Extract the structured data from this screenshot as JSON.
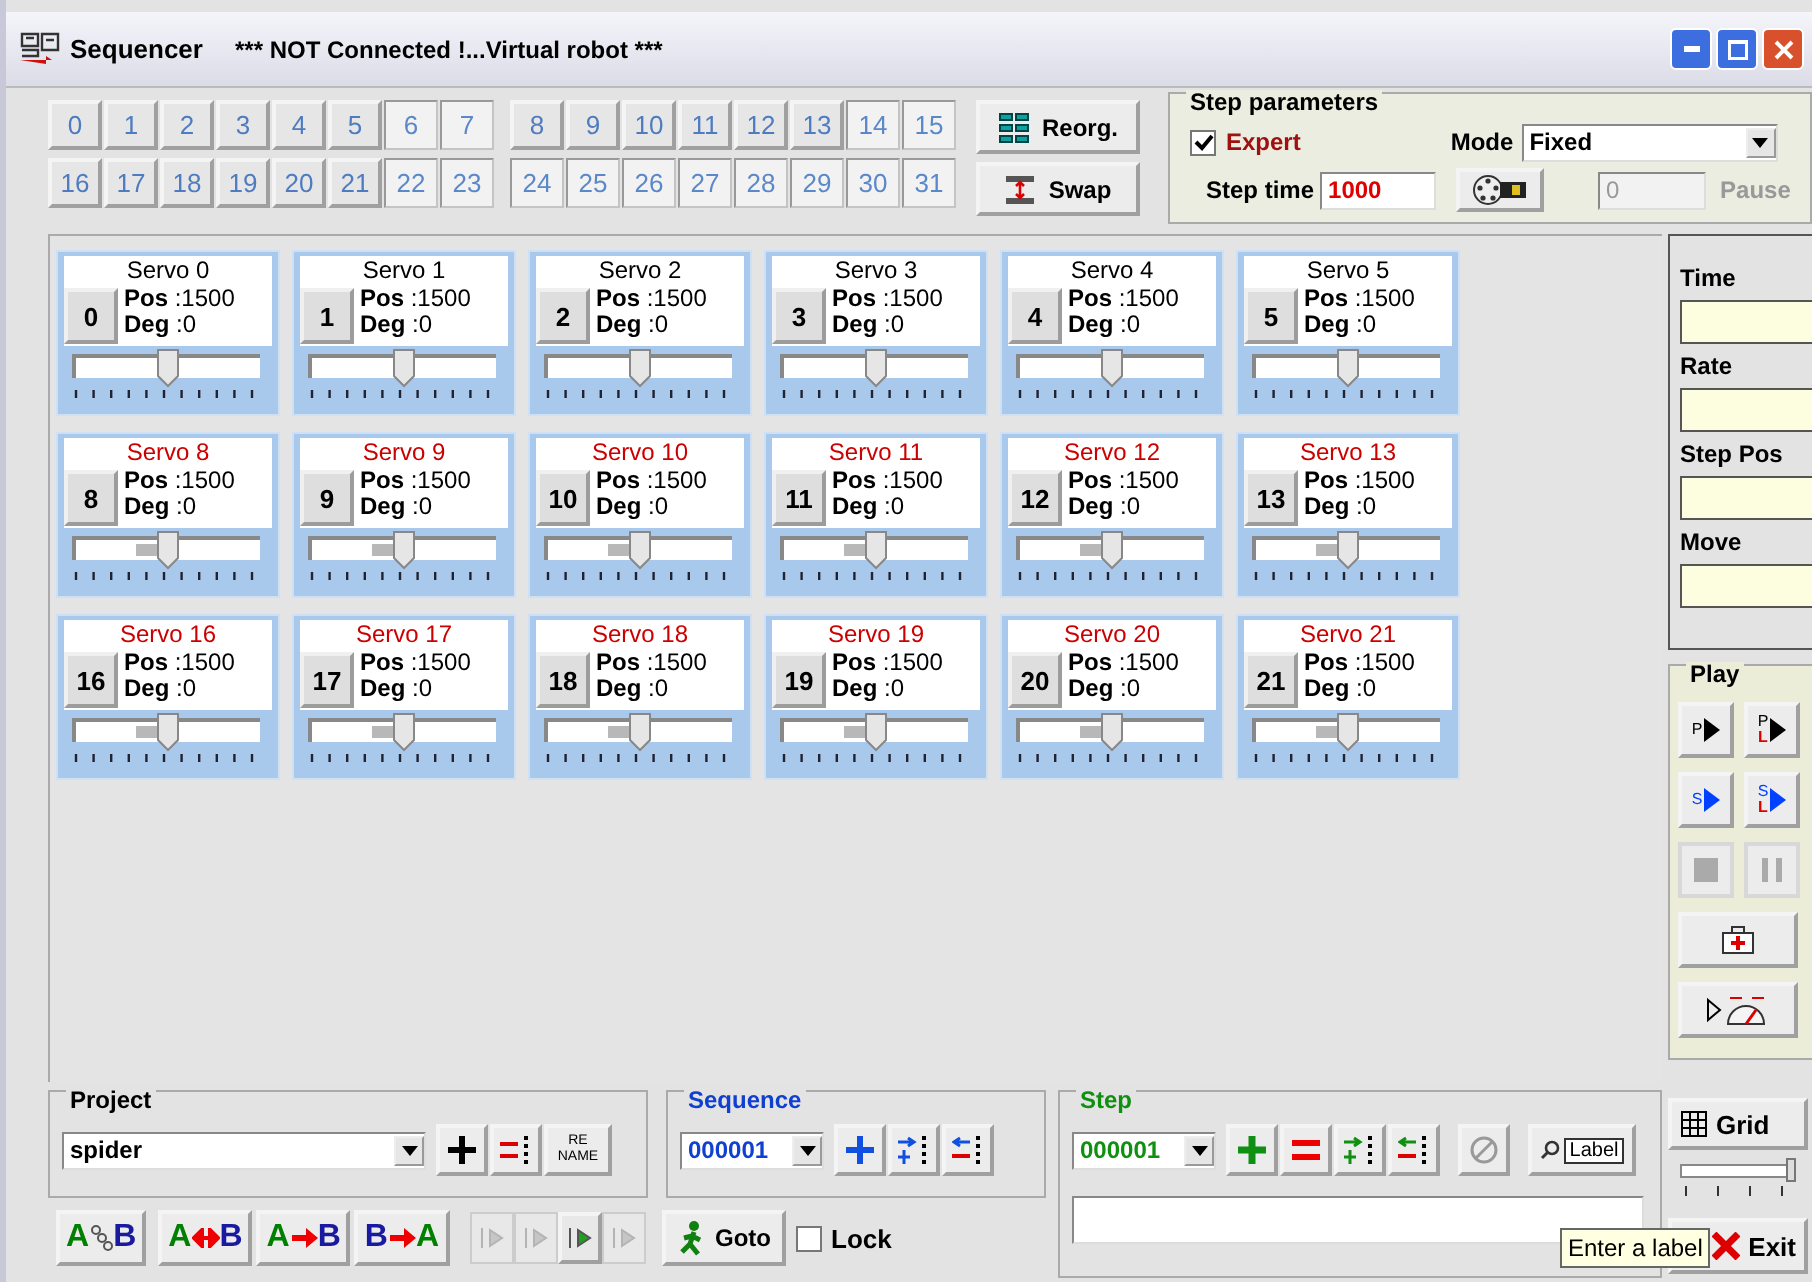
{
  "window": {
    "title": "Sequencer",
    "status": "*** NOT Connected !...Virtual robot ***"
  },
  "servo_buttons": [
    {
      "label": "0",
      "raised": true
    },
    {
      "label": "1",
      "raised": true
    },
    {
      "label": "2",
      "raised": true
    },
    {
      "label": "3",
      "raised": true
    },
    {
      "label": "4",
      "raised": true
    },
    {
      "label": "5",
      "raised": true
    },
    {
      "label": "6",
      "raised": false
    },
    {
      "label": "7",
      "raised": false
    },
    {
      "label": "8",
      "raised": true
    },
    {
      "label": "9",
      "raised": true
    },
    {
      "label": "10",
      "raised": true
    },
    {
      "label": "11",
      "raised": true
    },
    {
      "label": "12",
      "raised": true
    },
    {
      "label": "13",
      "raised": true
    },
    {
      "label": "14",
      "raised": false
    },
    {
      "label": "15",
      "raised": false
    },
    {
      "label": "16",
      "raised": true
    },
    {
      "label": "17",
      "raised": true
    },
    {
      "label": "18",
      "raised": true
    },
    {
      "label": "19",
      "raised": true
    },
    {
      "label": "20",
      "raised": true
    },
    {
      "label": "21",
      "raised": true
    },
    {
      "label": "22",
      "raised": false
    },
    {
      "label": "23",
      "raised": false
    },
    {
      "label": "24",
      "raised": false
    },
    {
      "label": "25",
      "raised": false
    },
    {
      "label": "26",
      "raised": false
    },
    {
      "label": "27",
      "raised": false
    },
    {
      "label": "28",
      "raised": false
    },
    {
      "label": "29",
      "raised": false
    },
    {
      "label": "30",
      "raised": false
    },
    {
      "label": "31",
      "raised": false
    }
  ],
  "reorg_button": "Reorg.",
  "swap_button": "Swap",
  "step_parameters": {
    "title": "Step parameters",
    "expert": {
      "label": "Expert",
      "checked": true
    },
    "mode_label": "Mode",
    "mode": "Fixed",
    "step_time_label": "Step time",
    "step_time": "1000",
    "pause_value": "0",
    "pause_label": "Pause"
  },
  "servos": [
    {
      "title": "Servo 0",
      "number": "0",
      "pos_label": "Pos",
      "pos": ":1500",
      "deg_label": "Deg",
      "deg": ":0",
      "level": 0.5,
      "color": "#000000",
      "range": false
    },
    {
      "title": "Servo 1",
      "number": "1",
      "pos_label": "Pos",
      "pos": ":1500",
      "deg_label": "Deg",
      "deg": ":0",
      "level": 0.5,
      "color": "#000000",
      "range": false
    },
    {
      "title": "Servo 2",
      "number": "2",
      "pos_label": "Pos",
      "pos": ":1500",
      "deg_label": "Deg",
      "deg": ":0",
      "level": 0.5,
      "color": "#000000",
      "range": false
    },
    {
      "title": "Servo 3",
      "number": "3",
      "pos_label": "Pos",
      "pos": ":1500",
      "deg_label": "Deg",
      "deg": ":0",
      "level": 0.5,
      "color": "#000000",
      "range": false
    },
    {
      "title": "Servo 4",
      "number": "4",
      "pos_label": "Pos",
      "pos": ":1500",
      "deg_label": "Deg",
      "deg": ":0",
      "level": 0.5,
      "color": "#000000",
      "range": false
    },
    {
      "title": "Servo 5",
      "number": "5",
      "pos_label": "Pos",
      "pos": ":1500",
      "deg_label": "Deg",
      "deg": ":0",
      "level": 0.5,
      "color": "#000000",
      "range": false
    },
    {
      "title": "Servo 8",
      "number": "8",
      "pos_label": "Pos",
      "pos": ":1500",
      "deg_label": "Deg",
      "deg": ":0",
      "level": 0.5,
      "color": "#cc0000",
      "range": true
    },
    {
      "title": "Servo 9",
      "number": "9",
      "pos_label": "Pos",
      "pos": ":1500",
      "deg_label": "Deg",
      "deg": ":0",
      "level": 0.5,
      "color": "#cc0000",
      "range": true
    },
    {
      "title": "Servo 10",
      "number": "10",
      "pos_label": "Pos",
      "pos": ":1500",
      "deg_label": "Deg",
      "deg": ":0",
      "level": 0.5,
      "color": "#cc0000",
      "range": true
    },
    {
      "title": "Servo 11",
      "number": "11",
      "pos_label": "Pos",
      "pos": ":1500",
      "deg_label": "Deg",
      "deg": ":0",
      "level": 0.5,
      "color": "#cc0000",
      "range": true
    },
    {
      "title": "Servo 12",
      "number": "12",
      "pos_label": "Pos",
      "pos": ":1500",
      "deg_label": "Deg",
      "deg": ":0",
      "level": 0.5,
      "color": "#cc0000",
      "range": true
    },
    {
      "title": "Servo 13",
      "number": "13",
      "pos_label": "Pos",
      "pos": ":1500",
      "deg_label": "Deg",
      "deg": ":0",
      "level": 0.5,
      "color": "#cc0000",
      "range": true
    },
    {
      "title": "Servo 16",
      "number": "16",
      "pos_label": "Pos",
      "pos": ":1500",
      "deg_label": "Deg",
      "deg": ":0",
      "level": 0.5,
      "color": "#cc0000",
      "range": true
    },
    {
      "title": "Servo 17",
      "number": "17",
      "pos_label": "Pos",
      "pos": ":1500",
      "deg_label": "Deg",
      "deg": ":0",
      "level": 0.5,
      "color": "#cc0000",
      "range": true
    },
    {
      "title": "Servo 18",
      "number": "18",
      "pos_label": "Pos",
      "pos": ":1500",
      "deg_label": "Deg",
      "deg": ":0",
      "level": 0.5,
      "color": "#cc0000",
      "range": true
    },
    {
      "title": "Servo 19",
      "number": "19",
      "pos_label": "Pos",
      "pos": ":1500",
      "deg_label": "Deg",
      "deg": ":0",
      "level": 0.5,
      "color": "#cc0000",
      "range": true
    },
    {
      "title": "Servo 20",
      "number": "20",
      "pos_label": "Pos",
      "pos": ":1500",
      "deg_label": "Deg",
      "deg": ":0",
      "level": 0.5,
      "color": "#cc0000",
      "range": true
    },
    {
      "title": "Servo 21",
      "number": "21",
      "pos_label": "Pos",
      "pos": ":1500",
      "deg_label": "Deg",
      "deg": ":0",
      "level": 0.5,
      "color": "#cc0000",
      "range": true
    }
  ],
  "info": [
    "Time",
    "Rate",
    "Step Pos",
    "Move"
  ],
  "play": {
    "title": "Play",
    "buttons": [
      {
        "kind": "run",
        "letter": "P",
        "color": "#000000",
        "disabled": false
      },
      {
        "kind": "run",
        "letter": "P",
        "sub": "L",
        "color": "#000000",
        "disabled": false
      },
      {
        "kind": "run",
        "letter": "S",
        "color": "#0040ff",
        "disabled": false
      },
      {
        "kind": "run",
        "letter": "S",
        "sub": "L",
        "color": "#0040ff",
        "disabled": false
      },
      {
        "kind": "stop",
        "disabled": true
      },
      {
        "kind": "pause",
        "disabled": true
      }
    ]
  },
  "grid_button": "Grid",
  "grid_slider": {
    "level": 1
  },
  "exit_button": "Exit",
  "project": {
    "title": "Project",
    "value": "spider",
    "rename": [
      "RE",
      "NAME"
    ]
  },
  "sequence": {
    "title": "Sequence",
    "value": "000001"
  },
  "step": {
    "title": "Step",
    "value": "000001",
    "label_button": "Label"
  },
  "transfer_buttons": [
    {
      "kind": "link",
      "left": {
        "text": "A",
        "color": "#008000"
      },
      "right": {
        "text": "B",
        "color": "#1a1aa0"
      }
    },
    {
      "kind": "swap",
      "left": {
        "text": "A",
        "color": "#008000"
      },
      "right": {
        "text": "B",
        "color": "#1a1aa0"
      }
    },
    {
      "kind": "copy",
      "left": {
        "text": "A",
        "color": "#008000"
      },
      "right": {
        "text": "B",
        "color": "#1a1aa0"
      }
    },
    {
      "kind": "copy",
      "left": {
        "text": "B",
        "color": "#1a1aa0"
      },
      "right": {
        "text": "A",
        "color": "#008000"
      }
    }
  ],
  "nav_buttons": [
    {
      "disabled": true
    },
    {
      "disabled": true
    },
    {
      "disabled": false
    },
    {
      "disabled": true
    }
  ],
  "goto_button": "Goto",
  "lock": {
    "label": "Lock",
    "checked": false
  },
  "tooltip": "Enter a label"
}
